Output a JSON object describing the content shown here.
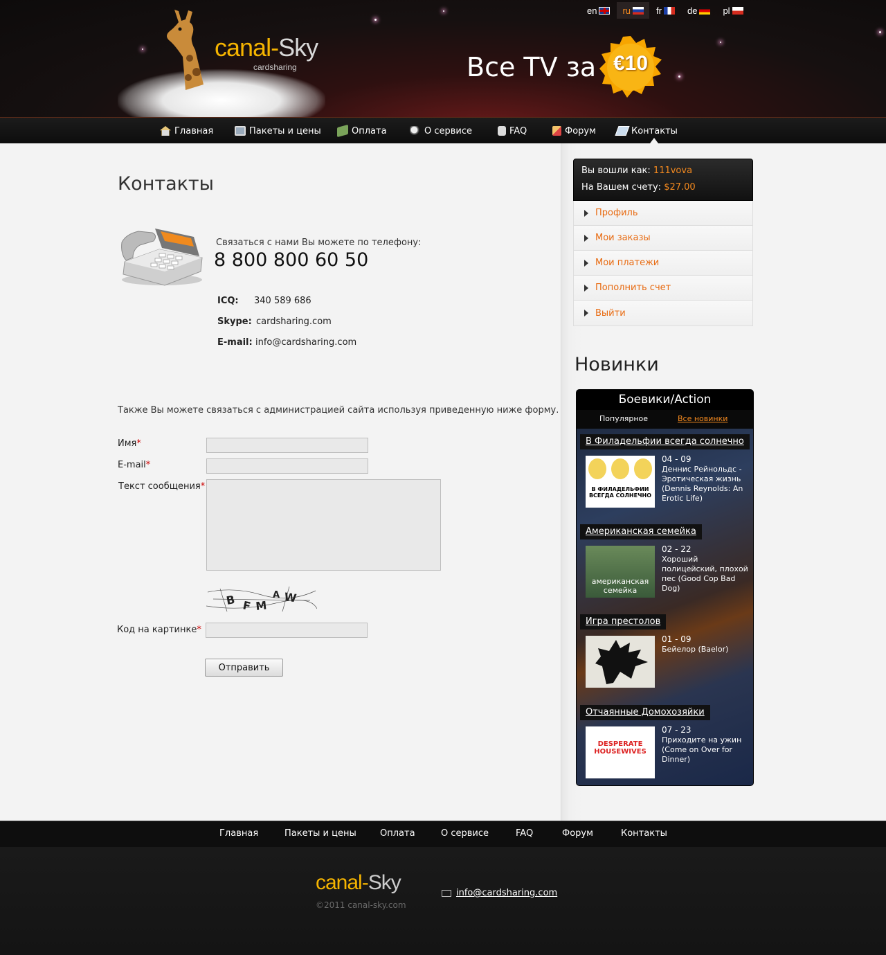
{
  "header": {
    "logo_a": "canal-",
    "logo_b": "Sky",
    "logo_sub": "cardsharing",
    "promo": "Все TV за",
    "badge": "€10",
    "languages": [
      {
        "code": "en",
        "active": false
      },
      {
        "code": "ru",
        "active": true
      },
      {
        "code": "fr",
        "active": false
      },
      {
        "code": "de",
        "active": false
      },
      {
        "code": "pl",
        "active": false
      }
    ]
  },
  "nav": {
    "items": [
      "Главная",
      "Пакеты и цены",
      "Оплата",
      "О сервисе",
      "FAQ",
      "Форум",
      "Контакты"
    ],
    "active": "Контакты"
  },
  "main": {
    "title": "Контакты",
    "phone_text": "Связаться с нами Вы можете по телефону:",
    "phone_number": "8 800 800 60 50",
    "icq_label": "ICQ:",
    "icq_value": "340 589 686",
    "skype_label": "Skype:",
    "skype_value": "cardsharing.com",
    "email_label": "E-mail:",
    "email_value": "info@cardsharing.com",
    "intro": "Также Вы можете связаться с администрацией сайта используя приведенную ниже форму.",
    "form": {
      "name_label": "Имя",
      "email_label": "E-mail",
      "message_label": "Текст сообщения",
      "captcha_label": "Код на картинке",
      "required_mark": "*",
      "submit_label": "Отправить",
      "captcha_text": "BFMAW"
    }
  },
  "user": {
    "logged_label": "Вы вошли как:",
    "username": "111vova",
    "balance_label": "На Вашем счету:",
    "balance": "$27.00",
    "menu": [
      "Профиль",
      "Мои заказы",
      "Мои платежи",
      "Пополнить счет",
      "Выйти"
    ]
  },
  "news": {
    "title": "Новинки",
    "category": "Боевики/Action",
    "tab_popular": "Популярное",
    "tab_all": "Все новинки",
    "shows": [
      {
        "title": "В Филадельфии всегда солнечно",
        "episode": "04 - 09",
        "desc": "Деннис Рейнольдс - Эротическая жизнь (Dennis Reynolds: An Erotic Life)",
        "poster_text": "В ФИЛАДЕЛЬФИИ ВСЕГДА СОЛНЕЧНО"
      },
      {
        "title": "Американская семейка",
        "episode": "02 - 22",
        "desc": "Хороший полицейский, плохой пес (Good Cop Bad Dog)",
        "poster_text": "американская семейка"
      },
      {
        "title": "Игра престолов",
        "episode": "01 - 09",
        "desc": "Бейелор (Baelor)",
        "poster_text": ""
      },
      {
        "title": "Отчаянные Домохозяйки",
        "episode": "07 - 23",
        "desc": "Приходите на ужин (Come on Over for Dinner)",
        "poster_text": "DESPERATE HOUSEWIVES"
      }
    ]
  },
  "footer": {
    "nav": [
      "Главная",
      "Пакеты и цены",
      "Оплата",
      "О сервисе",
      "FAQ",
      "Форум",
      "Контакты"
    ],
    "logo_a": "canal-",
    "logo_b": "Sky",
    "copyright": "©2011  canal-sky.com",
    "email": "info@cardsharing.com"
  },
  "colors": {
    "accent": "#f58a1f",
    "brand_yellow": "#f5b400",
    "required": "#cc0000"
  }
}
